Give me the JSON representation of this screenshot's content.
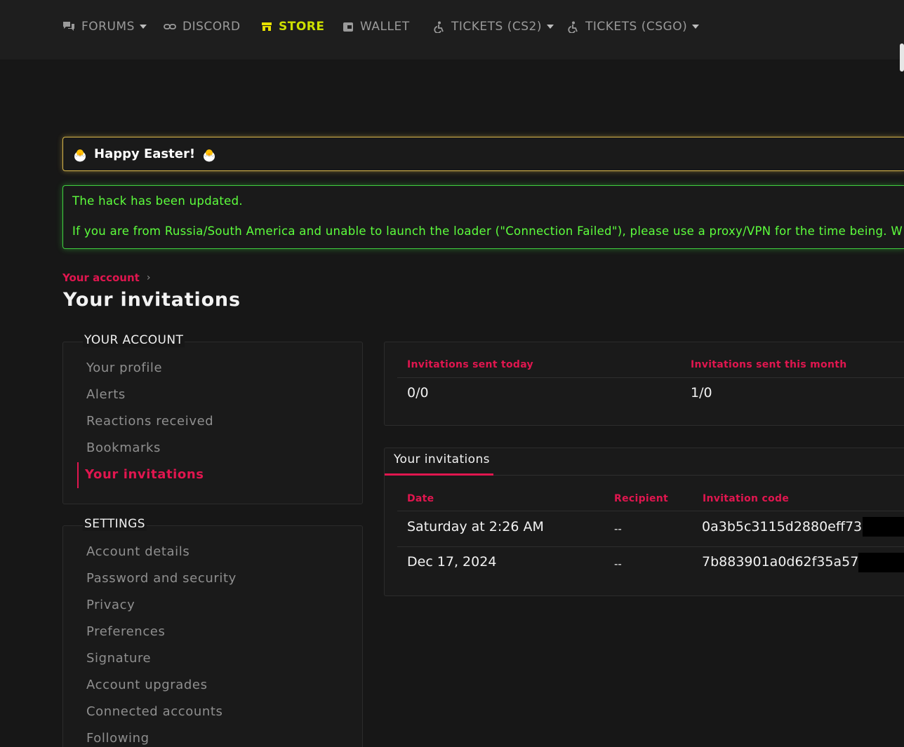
{
  "nav": {
    "items": [
      {
        "label": "FORUMS",
        "icon": "chat-icon",
        "dropdown": true
      },
      {
        "label": "DISCORD",
        "icon": "link-icon",
        "dropdown": false
      },
      {
        "label": "STORE",
        "icon": "store-icon",
        "dropdown": false,
        "active": true
      },
      {
        "label": "WALLET",
        "icon": "wallet-icon",
        "dropdown": false
      },
      {
        "label": "TICKETS (CS2)",
        "icon": "accessibility-icon",
        "dropdown": true
      },
      {
        "label": "TICKETS (CSGO)",
        "icon": "accessibility-icon",
        "dropdown": true
      }
    ],
    "active_color": "#cde000"
  },
  "notices": {
    "easter": "Happy Easter!",
    "update_line1": "The hack has been updated.",
    "update_line2": "If you are from Russia/South America and unable to launch the loader (\"Connection Failed\"), please use a proxy/VPN for the time being. W"
  },
  "breadcrumb": {
    "label": "Your account"
  },
  "page": {
    "title": "Your invitations"
  },
  "sidebar": {
    "account_heading": "YOUR ACCOUNT",
    "account_items": [
      "Your profile",
      "Alerts",
      "Reactions received",
      "Bookmarks",
      "Your invitations"
    ],
    "settings_heading": "SETTINGS",
    "settings_items": [
      "Account details",
      "Password and security",
      "Privacy",
      "Preferences",
      "Signature",
      "Account upgrades",
      "Connected accounts",
      "Following"
    ]
  },
  "stats": {
    "today_label": "Invitations sent today",
    "today_value": "0/0",
    "month_label": "Invitations sent this month",
    "month_value": "1/0"
  },
  "invitations": {
    "tab_label": "Your invitations",
    "columns": [
      "Date",
      "Recipient",
      "Invitation code"
    ],
    "rows": [
      {
        "date": "Saturday at 2:26 AM",
        "recipient": "--",
        "code": "0a3b5c3115d2880eff73417"
      },
      {
        "date": "Dec 17, 2024",
        "recipient": "--",
        "code": "7b883901a0d62f35a5735"
      }
    ]
  },
  "colors": {
    "accent": "#e0164f",
    "easter_border": "#d6b54a",
    "update_border": "#3fcf3f",
    "update_text": "#5dff3d",
    "background": "#171717"
  }
}
